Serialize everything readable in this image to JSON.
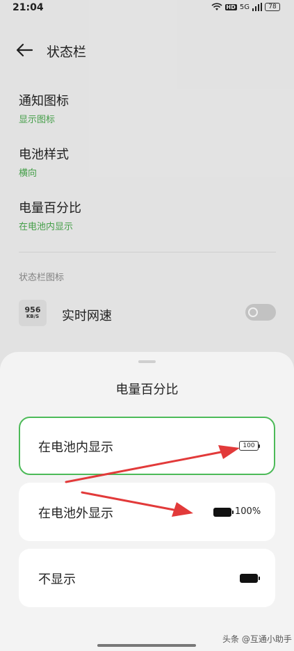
{
  "status_bar": {
    "time": "21:04",
    "battery": "78",
    "hd": "HD",
    "signal_label": "5G"
  },
  "header": {
    "title": "状态栏"
  },
  "settings": [
    {
      "title": "通知图标",
      "subtitle": "显示图标"
    },
    {
      "title": "电池样式",
      "subtitle": "横向"
    },
    {
      "title": "电量百分比",
      "subtitle": "在电池内显示"
    }
  ],
  "section": {
    "label": "状态栏图标"
  },
  "net_speed": {
    "value": "956",
    "unit": "KB/S",
    "label": "实时网速",
    "enabled": false
  },
  "sheet": {
    "title": "电量百分比",
    "options": [
      {
        "label": "在电池内显示",
        "battery_text": "100",
        "selected": true
      },
      {
        "label": "在电池外显示",
        "battery_text": "100%",
        "selected": false
      },
      {
        "label": "不显示",
        "selected": false
      }
    ]
  },
  "colors": {
    "accent": "#4cba58",
    "subtitle_green": "#4aa94e",
    "arrow_red": "#e23a3a"
  },
  "watermark": "头条 @互通小助手"
}
